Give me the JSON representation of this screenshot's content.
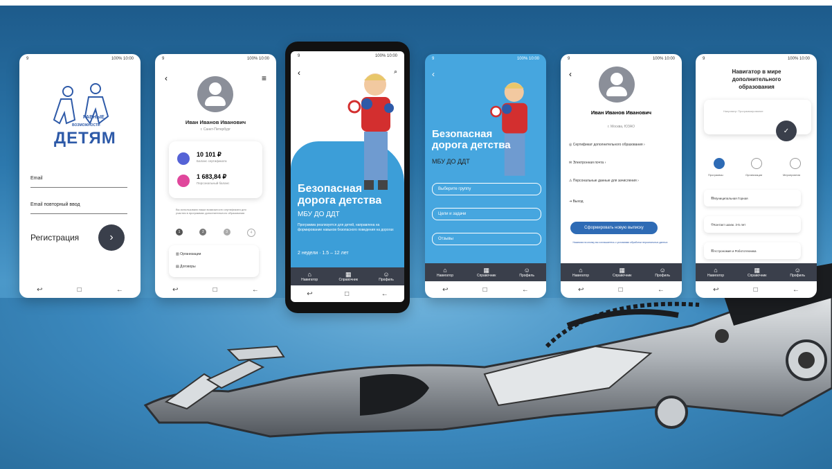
{
  "phones": {
    "p1": {
      "logo_line1": "РАВНЫЕ",
      "logo_line2": "ВОЗМОЖНОСТИ",
      "logo_main": "ДЕТЯМ",
      "email_label": "Email",
      "password_label": "Email повторный ввод",
      "register_label": "Регистрация"
    },
    "p2": {
      "user_name": "Иван Иванов Иванович",
      "user_city": "г. Санкт-Петербург",
      "balance1_value": "10 101 ₽",
      "balance1_label": "Баланс сертификата",
      "balance2_value": "1 683,84 ₽",
      "balance2_label": "Персональный баланс",
      "note": "Вы использовали ваши возможности сертификата для участия в программах дополнительного образования",
      "steps": [
        "1",
        "2",
        "3",
        "4"
      ],
      "link1": "Организации",
      "link2": "Договоры"
    },
    "p3": {
      "headline": "Безопасная дорога детства",
      "org": "МБУ ДО ДДТ",
      "description": "Программа реализуется для детей, направлена на формирование навыков безопасного поведения на дорогах",
      "duration": "2 недели · 1.5 – 12 лет"
    },
    "p4": {
      "headline": "Безопасная дорога детства",
      "org": "МБУ ДО ДДТ",
      "buttons": [
        "Выберите группу",
        "Цели и задачи",
        "Отзывы"
      ]
    },
    "p5": {
      "user_name": "Иван Иванов Иванович",
      "user_city": "г. Москва, ЮЗАО",
      "menu": [
        "Сертификат дополнительного образования",
        "Электронная почта",
        "Персональные данные для зачисления",
        "Выход"
      ],
      "cta": "Сформировать новую выписку",
      "fine_print": "Нажимая на кнопку вы соглашаетесь с условиями обработки персональных данных"
    },
    "p6": {
      "title": "Навигатор в мире дополнительного образования",
      "search_placeholder": "Например: Программирование",
      "radio_labels": [
        "Программы",
        "Организации",
        "Мероприятия"
      ],
      "list": [
        "Муниципальная Горная",
        "Контакт шахм. 3-5 лет",
        "Астрономия и Робототехника"
      ]
    }
  },
  "tabs": {
    "home": "Навигатор",
    "catalog": "Справочник",
    "profile": "Профиль"
  },
  "status": {
    "left": "9",
    "right": "100% 10:00"
  },
  "nav": {
    "back": "↩",
    "home": "□",
    "recent": "←"
  }
}
